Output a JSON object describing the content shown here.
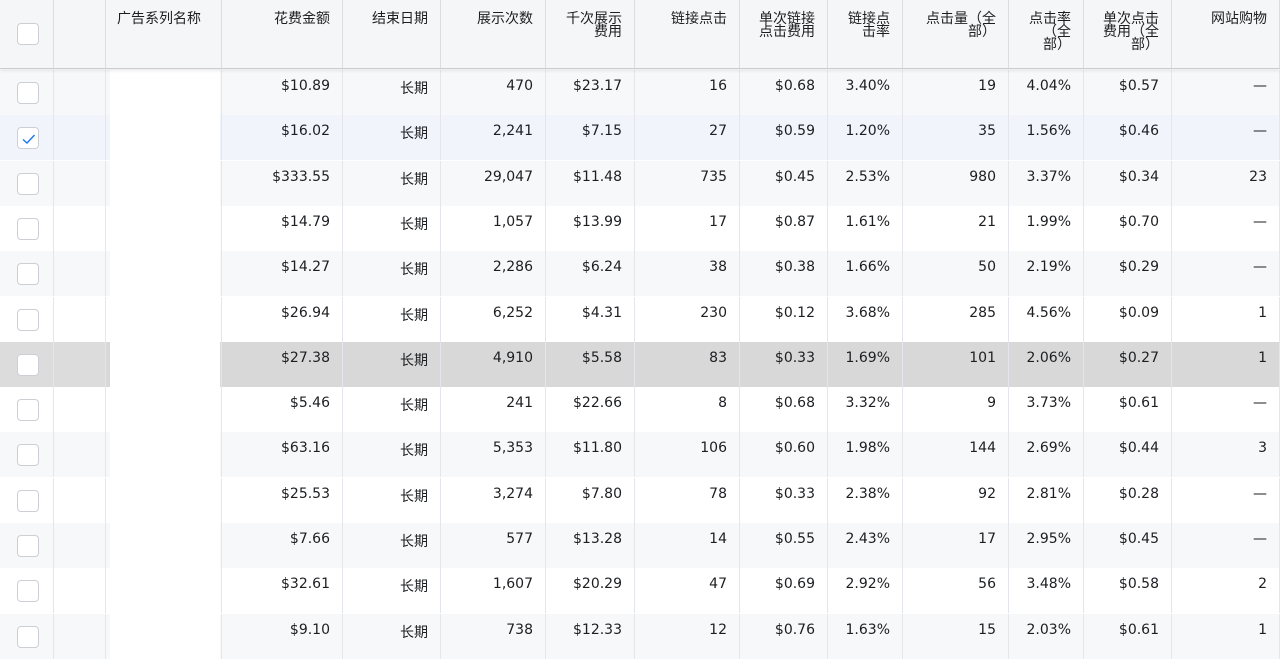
{
  "table": {
    "header": {
      "name": "广告系列名称",
      "spend": "花费金额",
      "end_date": "结束日期",
      "impressions": "展示次数",
      "cpm": "千次展示\n费用",
      "link_clicks": "链接点击",
      "cpc_link": "单次链接\n点击费用",
      "ctr_link": "链接点\n击率",
      "clicks_all": "点击量（全\n部）",
      "ctr_all": "点击率\n（全\n部）",
      "cpc_all": "单次点击\n费用（全\n部）",
      "purchases": "网站购物"
    },
    "rows": [
      {
        "spend": "$10.89",
        "end_date": "长期",
        "impressions": "470",
        "cpm": "$23.17",
        "link_clicks": "16",
        "cpc_link": "$0.68",
        "ctr_link": "3.40%",
        "clicks_all": "19",
        "ctr_all": "4.04%",
        "cpc_all": "$0.57",
        "purchases": "—",
        "checked": false
      },
      {
        "spend": "$16.02",
        "end_date": "长期",
        "impressions": "2,241",
        "cpm": "$7.15",
        "link_clicks": "27",
        "cpc_link": "$0.59",
        "ctr_link": "1.20%",
        "clicks_all": "35",
        "ctr_all": "1.56%",
        "cpc_all": "$0.46",
        "purchases": "—",
        "checked": true
      },
      {
        "spend": "$333.55",
        "end_date": "长期",
        "impressions": "29,047",
        "cpm": "$11.48",
        "link_clicks": "735",
        "cpc_link": "$0.45",
        "ctr_link": "2.53%",
        "clicks_all": "980",
        "ctr_all": "3.37%",
        "cpc_all": "$0.34",
        "purchases": "23",
        "checked": false
      },
      {
        "spend": "$14.79",
        "end_date": "长期",
        "impressions": "1,057",
        "cpm": "$13.99",
        "link_clicks": "17",
        "cpc_link": "$0.87",
        "ctr_link": "1.61%",
        "clicks_all": "21",
        "ctr_all": "1.99%",
        "cpc_all": "$0.70",
        "purchases": "—",
        "checked": false
      },
      {
        "spend": "$14.27",
        "end_date": "长期",
        "impressions": "2,286",
        "cpm": "$6.24",
        "link_clicks": "38",
        "cpc_link": "$0.38",
        "ctr_link": "1.66%",
        "clicks_all": "50",
        "ctr_all": "2.19%",
        "cpc_all": "$0.29",
        "purchases": "—",
        "checked": false
      },
      {
        "spend": "$26.94",
        "end_date": "长期",
        "impressions": "6,252",
        "cpm": "$4.31",
        "link_clicks": "230",
        "cpc_link": "$0.12",
        "ctr_link": "3.68%",
        "clicks_all": "285",
        "ctr_all": "4.56%",
        "cpc_all": "$0.09",
        "purchases": "1",
        "checked": false
      },
      {
        "spend": "$27.38",
        "end_date": "长期",
        "impressions": "4,910",
        "cpm": "$5.58",
        "link_clicks": "83",
        "cpc_link": "$0.33",
        "ctr_link": "1.69%",
        "clicks_all": "101",
        "ctr_all": "2.06%",
        "cpc_all": "$0.27",
        "purchases": "1",
        "checked": false
      },
      {
        "spend": "$5.46",
        "end_date": "长期",
        "impressions": "241",
        "cpm": "$22.66",
        "link_clicks": "8",
        "cpc_link": "$0.68",
        "ctr_link": "3.32%",
        "clicks_all": "9",
        "ctr_all": "3.73%",
        "cpc_all": "$0.61",
        "purchases": "—",
        "checked": false
      },
      {
        "spend": "$63.16",
        "end_date": "长期",
        "impressions": "5,353",
        "cpm": "$11.80",
        "link_clicks": "106",
        "cpc_link": "$0.60",
        "ctr_link": "1.98%",
        "clicks_all": "144",
        "ctr_all": "2.69%",
        "cpc_all": "$0.44",
        "purchases": "3",
        "checked": false
      },
      {
        "spend": "$25.53",
        "end_date": "长期",
        "impressions": "3,274",
        "cpm": "$7.80",
        "link_clicks": "78",
        "cpc_link": "$0.33",
        "ctr_link": "2.38%",
        "clicks_all": "92",
        "ctr_all": "2.81%",
        "cpc_all": "$0.28",
        "purchases": "—",
        "checked": false
      },
      {
        "spend": "$7.66",
        "end_date": "长期",
        "impressions": "577",
        "cpm": "$13.28",
        "link_clicks": "14",
        "cpc_link": "$0.55",
        "ctr_link": "2.43%",
        "clicks_all": "17",
        "ctr_all": "2.95%",
        "cpc_all": "$0.45",
        "purchases": "—",
        "checked": false
      },
      {
        "spend": "$32.61",
        "end_date": "长期",
        "impressions": "1,607",
        "cpm": "$20.29",
        "link_clicks": "47",
        "cpc_link": "$0.69",
        "ctr_link": "2.92%",
        "clicks_all": "56",
        "ctr_all": "3.48%",
        "cpc_all": "$0.58",
        "purchases": "2",
        "checked": false
      },
      {
        "spend": "$9.10",
        "end_date": "长期",
        "impressions": "738",
        "cpm": "$12.33",
        "link_clicks": "12",
        "cpc_link": "$0.76",
        "ctr_link": "1.63%",
        "clicks_all": "15",
        "ctr_all": "2.03%",
        "cpc_all": "$0.61",
        "purchases": "1",
        "checked": false
      }
    ]
  },
  "icons": {
    "row_checkbox": "checkbox-icon",
    "checked_mark": "checkmark-icon",
    "status_toggle": "toggle-switch-icon"
  },
  "colors": {
    "header_bg": "#f5f6f7",
    "row_alt_bg": "#f7f8fa",
    "selected_row_bg": "#f2f4fc",
    "hovered_row_bg": "#d8d8d8",
    "check_blue": "#1877f2",
    "toggle_off_track": "#e4e6eb",
    "toggle_knob": "#606770"
  }
}
